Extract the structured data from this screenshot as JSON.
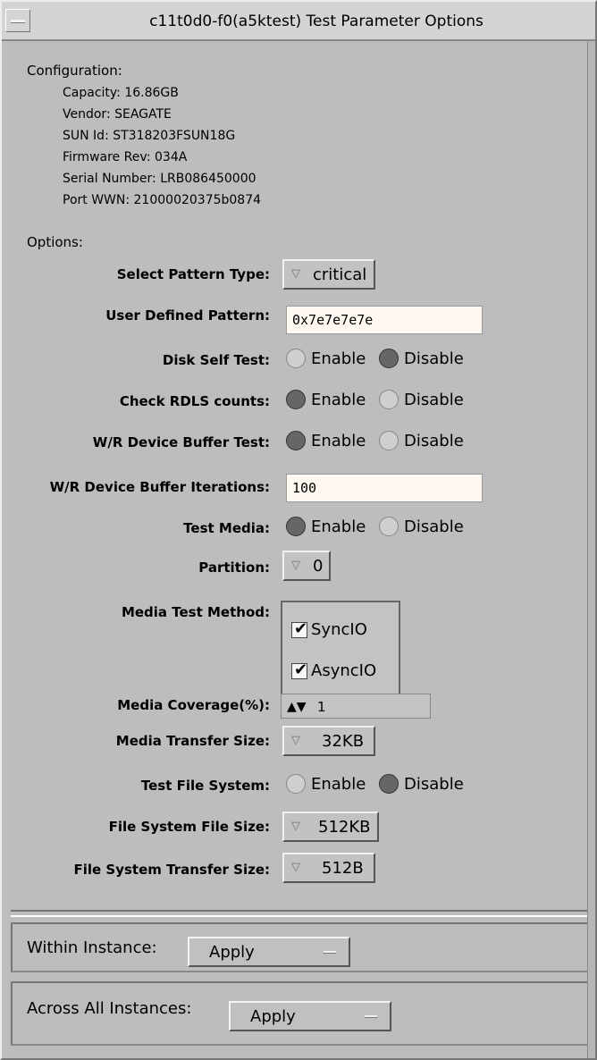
{
  "window": {
    "title": "c11t0d0-f0(a5ktest) Test Parameter Options"
  },
  "configuration": {
    "heading": "Configuration:",
    "items": [
      "Capacity: 16.86GB",
      "Vendor: SEAGATE",
      "SUN Id: ST318203FSUN18G",
      "Firmware Rev: 034A",
      "Serial Number: LRB086450000",
      "Port WWN: 21000020375b0874"
    ]
  },
  "options": {
    "heading": "Options:",
    "select_pattern_type": {
      "label": "Select Pattern Type:",
      "value": "critical"
    },
    "user_defined_pattern": {
      "label": "User Defined Pattern:",
      "value": "0x7e7e7e7e"
    },
    "disk_self_test": {
      "label": "Disk Self Test:",
      "enable": "Enable",
      "disable": "Disable",
      "selected": "Disable"
    },
    "check_rdls_counts": {
      "label": "Check RDLS counts:",
      "enable": "Enable",
      "disable": "Disable",
      "selected": "Enable"
    },
    "wr_device_buffer_test": {
      "label": "W/R Device Buffer Test:",
      "enable": "Enable",
      "disable": "Disable",
      "selected": "Enable"
    },
    "wr_device_buffer_iterations": {
      "label": "W/R Device Buffer Iterations:",
      "value": "100"
    },
    "test_media": {
      "label": "Test Media:",
      "enable": "Enable",
      "disable": "Disable",
      "selected": "Enable"
    },
    "partition": {
      "label": "Partition:",
      "value": "0"
    },
    "media_test_method": {
      "label": "Media Test Method:",
      "items": [
        "SyncIO",
        "AsyncIO"
      ]
    },
    "media_coverage": {
      "label": "Media Coverage(%):",
      "value": "1",
      "arrows": "▲▼"
    },
    "media_transfer_size": {
      "label": "Media Transfer Size:",
      "value": "32KB"
    },
    "test_file_system": {
      "label": "Test File System:",
      "enable": "Enable",
      "disable": "Disable",
      "selected": "Disable"
    },
    "file_system_file_size": {
      "label": "File System File Size:",
      "value": "512KB"
    },
    "file_system_transfer_size": {
      "label": "File System Transfer Size:",
      "value": "512B"
    }
  },
  "apply": {
    "within_instance": {
      "label": "Within Instance:",
      "button": "Apply"
    },
    "across_all_instances": {
      "label": "Across All Instances:",
      "button": "Apply"
    }
  },
  "icons": {
    "window_menu": "window-menu-icon",
    "dropdown": "dropdown-arrow-icon",
    "checkmark": "check-icon",
    "spin": "spin-arrows-icon",
    "option_menu": "option-menu-icon"
  },
  "colors": {
    "window_bg": "#bdbdbd",
    "text_field_bg": "#fff8f0",
    "selected_radio": "#666666"
  }
}
